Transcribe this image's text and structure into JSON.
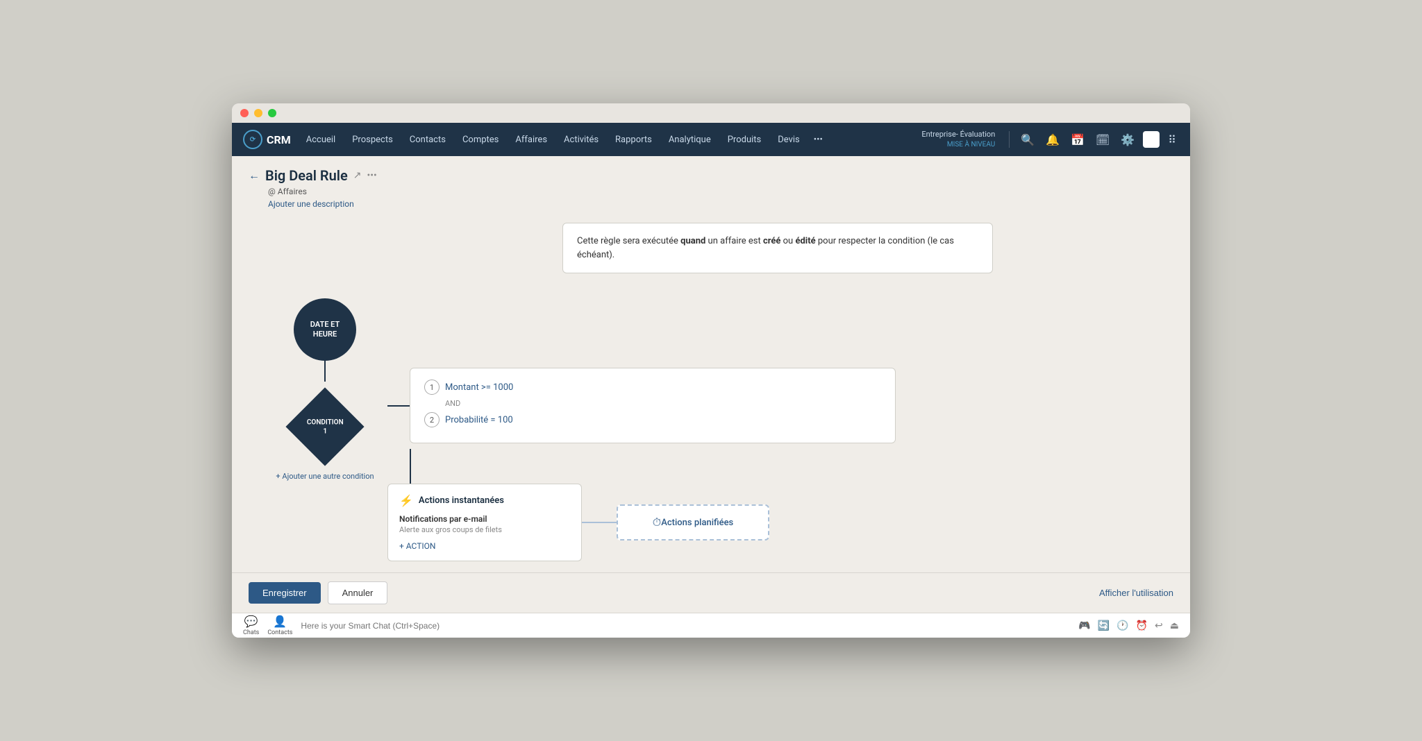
{
  "window": {
    "title": "Big Deal Rule"
  },
  "navbar": {
    "logo": "CRM",
    "items": [
      "Accueil",
      "Prospects",
      "Contacts",
      "Comptes",
      "Affaires",
      "Activités",
      "Rapports",
      "Analytique",
      "Produits",
      "Devis"
    ],
    "more": "•••",
    "enterprise": "Entreprise- Évaluation",
    "upgrade": "MISE À NIVEAU"
  },
  "breadcrumb": {
    "back": "←",
    "title": "Big Deal Rule",
    "subtitle": "@ Affaires",
    "add_desc": "Ajouter une description"
  },
  "info_box": {
    "text_before": "Cette règle sera exécutée ",
    "when": "quand",
    "text_middle": " un affaire est ",
    "created": "créé",
    "text_or": " ou ",
    "edited": "édité",
    "text_after": " pour respecter la condition (le cas échéant)."
  },
  "nodes": {
    "circle": {
      "label": "DATE ET\nHEURE"
    },
    "diamond": {
      "label": "CONDITION\n1"
    }
  },
  "condition_box": {
    "rows": [
      {
        "num": "1",
        "text": "Montant  >=  1000"
      },
      {
        "connector": "AND"
      },
      {
        "num": "2",
        "text": "Probabilité  =  100"
      }
    ]
  },
  "add_condition": "+ Ajouter une autre condition",
  "actions": {
    "instant": {
      "icon": "⚡",
      "title": "Actions instantanées",
      "sub_title": "Notifications par e-mail",
      "sub_text": "Alerte aux gros coups de filets",
      "add_action": "+ ACTION"
    },
    "planned": {
      "icon": "⏱",
      "title": "Actions planifiées"
    }
  },
  "buttons": {
    "save": "Enregistrer",
    "cancel": "Annuler",
    "usage": "Afficher l'utilisation"
  },
  "smartchat": {
    "placeholder": "Here is your Smart Chat (Ctrl+Space)",
    "tabs": [
      "Chats",
      "Contacts"
    ]
  }
}
